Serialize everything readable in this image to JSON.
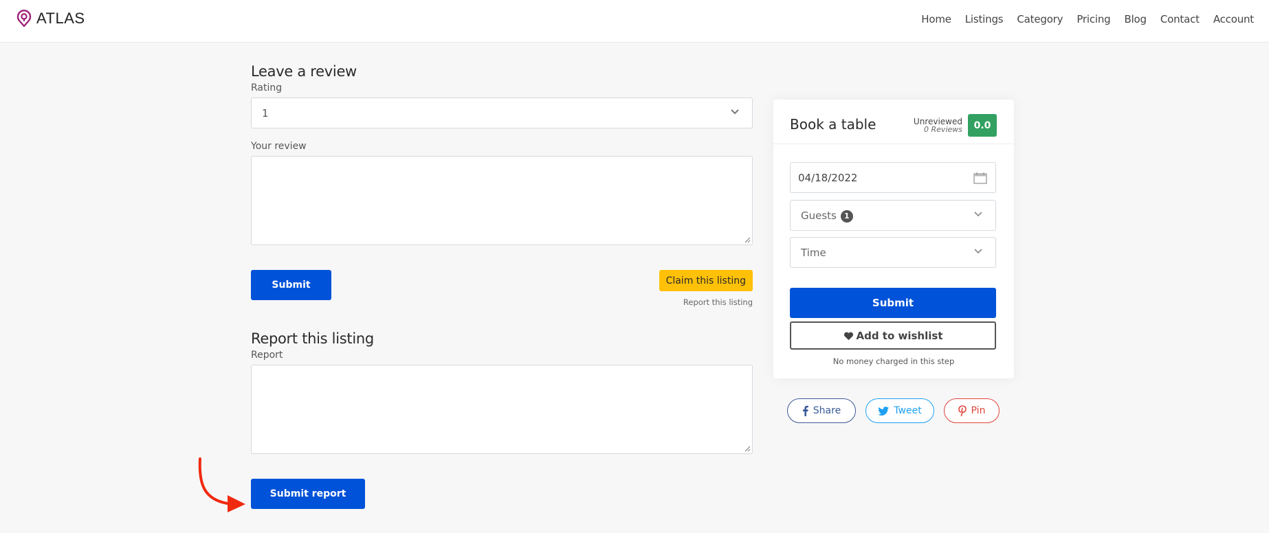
{
  "header": {
    "brand": "ATLAS",
    "brand_color": "#a0207a",
    "nav": [
      "Home",
      "Listings",
      "Category",
      "Pricing",
      "Blog",
      "Contact",
      "Account"
    ]
  },
  "review": {
    "title": "Leave a review",
    "rating_label": "Rating",
    "rating_value": "1",
    "review_label": "Your review",
    "review_value": "",
    "submit_label": "Submit",
    "claim_label": "Claim this listing",
    "report_link": "Report this listing"
  },
  "report": {
    "title": "Report this listing",
    "report_label": "Report",
    "report_value": "",
    "submit_label": "Submit report"
  },
  "booking": {
    "title": "Book a table",
    "status": "Unreviewed",
    "reviews": "0 Reviews",
    "score": "0.0",
    "date": "04/18/2022",
    "guests_label": "Guests",
    "guests_count": "1",
    "time_label": "Time",
    "submit_label": "Submit",
    "wishlist_label": "Add to wishlist",
    "note": "No money charged in this step"
  },
  "social": {
    "facebook": "Share",
    "twitter": "Tweet",
    "pinterest": "Pin"
  },
  "colors": {
    "primary": "#0052d9",
    "claim": "#ffc107",
    "score": "#32a060",
    "annotation_arrow": "#f02a10"
  }
}
